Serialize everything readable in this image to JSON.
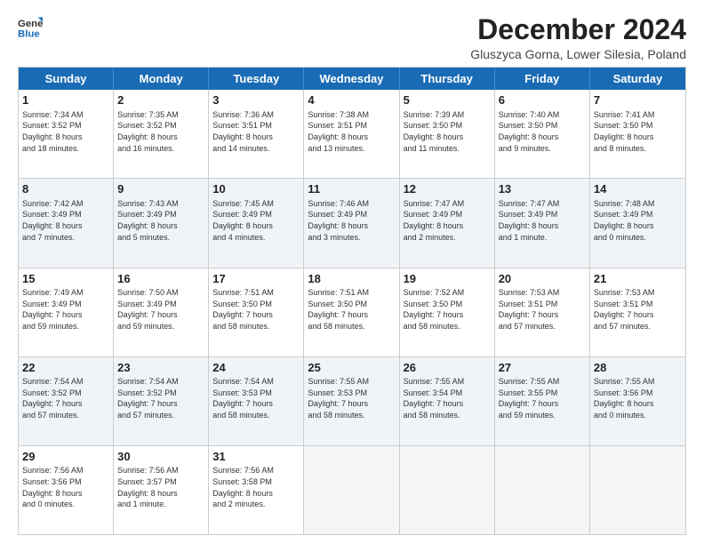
{
  "header": {
    "logo_line1": "General",
    "logo_line2": "Blue",
    "month_title": "December 2024",
    "location": "Gluszyca Gorna, Lower Silesia, Poland"
  },
  "weekdays": [
    "Sunday",
    "Monday",
    "Tuesday",
    "Wednesday",
    "Thursday",
    "Friday",
    "Saturday"
  ],
  "rows": [
    [
      {
        "day": "1",
        "lines": [
          "Sunrise: 7:34 AM",
          "Sunset: 3:52 PM",
          "Daylight: 8 hours",
          "and 18 minutes."
        ]
      },
      {
        "day": "2",
        "lines": [
          "Sunrise: 7:35 AM",
          "Sunset: 3:52 PM",
          "Daylight: 8 hours",
          "and 16 minutes."
        ]
      },
      {
        "day": "3",
        "lines": [
          "Sunrise: 7:36 AM",
          "Sunset: 3:51 PM",
          "Daylight: 8 hours",
          "and 14 minutes."
        ]
      },
      {
        "day": "4",
        "lines": [
          "Sunrise: 7:38 AM",
          "Sunset: 3:51 PM",
          "Daylight: 8 hours",
          "and 13 minutes."
        ]
      },
      {
        "day": "5",
        "lines": [
          "Sunrise: 7:39 AM",
          "Sunset: 3:50 PM",
          "Daylight: 8 hours",
          "and 11 minutes."
        ]
      },
      {
        "day": "6",
        "lines": [
          "Sunrise: 7:40 AM",
          "Sunset: 3:50 PM",
          "Daylight: 8 hours",
          "and 9 minutes."
        ]
      },
      {
        "day": "7",
        "lines": [
          "Sunrise: 7:41 AM",
          "Sunset: 3:50 PM",
          "Daylight: 8 hours",
          "and 8 minutes."
        ]
      }
    ],
    [
      {
        "day": "8",
        "lines": [
          "Sunrise: 7:42 AM",
          "Sunset: 3:49 PM",
          "Daylight: 8 hours",
          "and 7 minutes."
        ]
      },
      {
        "day": "9",
        "lines": [
          "Sunrise: 7:43 AM",
          "Sunset: 3:49 PM",
          "Daylight: 8 hours",
          "and 5 minutes."
        ]
      },
      {
        "day": "10",
        "lines": [
          "Sunrise: 7:45 AM",
          "Sunset: 3:49 PM",
          "Daylight: 8 hours",
          "and 4 minutes."
        ]
      },
      {
        "day": "11",
        "lines": [
          "Sunrise: 7:46 AM",
          "Sunset: 3:49 PM",
          "Daylight: 8 hours",
          "and 3 minutes."
        ]
      },
      {
        "day": "12",
        "lines": [
          "Sunrise: 7:47 AM",
          "Sunset: 3:49 PM",
          "Daylight: 8 hours",
          "and 2 minutes."
        ]
      },
      {
        "day": "13",
        "lines": [
          "Sunrise: 7:47 AM",
          "Sunset: 3:49 PM",
          "Daylight: 8 hours",
          "and 1 minute."
        ]
      },
      {
        "day": "14",
        "lines": [
          "Sunrise: 7:48 AM",
          "Sunset: 3:49 PM",
          "Daylight: 8 hours",
          "and 0 minutes."
        ]
      }
    ],
    [
      {
        "day": "15",
        "lines": [
          "Sunrise: 7:49 AM",
          "Sunset: 3:49 PM",
          "Daylight: 7 hours",
          "and 59 minutes."
        ]
      },
      {
        "day": "16",
        "lines": [
          "Sunrise: 7:50 AM",
          "Sunset: 3:49 PM",
          "Daylight: 7 hours",
          "and 59 minutes."
        ]
      },
      {
        "day": "17",
        "lines": [
          "Sunrise: 7:51 AM",
          "Sunset: 3:50 PM",
          "Daylight: 7 hours",
          "and 58 minutes."
        ]
      },
      {
        "day": "18",
        "lines": [
          "Sunrise: 7:51 AM",
          "Sunset: 3:50 PM",
          "Daylight: 7 hours",
          "and 58 minutes."
        ]
      },
      {
        "day": "19",
        "lines": [
          "Sunrise: 7:52 AM",
          "Sunset: 3:50 PM",
          "Daylight: 7 hours",
          "and 58 minutes."
        ]
      },
      {
        "day": "20",
        "lines": [
          "Sunrise: 7:53 AM",
          "Sunset: 3:51 PM",
          "Daylight: 7 hours",
          "and 57 minutes."
        ]
      },
      {
        "day": "21",
        "lines": [
          "Sunrise: 7:53 AM",
          "Sunset: 3:51 PM",
          "Daylight: 7 hours",
          "and 57 minutes."
        ]
      }
    ],
    [
      {
        "day": "22",
        "lines": [
          "Sunrise: 7:54 AM",
          "Sunset: 3:52 PM",
          "Daylight: 7 hours",
          "and 57 minutes."
        ]
      },
      {
        "day": "23",
        "lines": [
          "Sunrise: 7:54 AM",
          "Sunset: 3:52 PM",
          "Daylight: 7 hours",
          "and 57 minutes."
        ]
      },
      {
        "day": "24",
        "lines": [
          "Sunrise: 7:54 AM",
          "Sunset: 3:53 PM",
          "Daylight: 7 hours",
          "and 58 minutes."
        ]
      },
      {
        "day": "25",
        "lines": [
          "Sunrise: 7:55 AM",
          "Sunset: 3:53 PM",
          "Daylight: 7 hours",
          "and 58 minutes."
        ]
      },
      {
        "day": "26",
        "lines": [
          "Sunrise: 7:55 AM",
          "Sunset: 3:54 PM",
          "Daylight: 7 hours",
          "and 58 minutes."
        ]
      },
      {
        "day": "27",
        "lines": [
          "Sunrise: 7:55 AM",
          "Sunset: 3:55 PM",
          "Daylight: 7 hours",
          "and 59 minutes."
        ]
      },
      {
        "day": "28",
        "lines": [
          "Sunrise: 7:55 AM",
          "Sunset: 3:56 PM",
          "Daylight: 8 hours",
          "and 0 minutes."
        ]
      }
    ],
    [
      {
        "day": "29",
        "lines": [
          "Sunrise: 7:56 AM",
          "Sunset: 3:56 PM",
          "Daylight: 8 hours",
          "and 0 minutes."
        ]
      },
      {
        "day": "30",
        "lines": [
          "Sunrise: 7:56 AM",
          "Sunset: 3:57 PM",
          "Daylight: 8 hours",
          "and 1 minute."
        ]
      },
      {
        "day": "31",
        "lines": [
          "Sunrise: 7:56 AM",
          "Sunset: 3:58 PM",
          "Daylight: 8 hours",
          "and 2 minutes."
        ]
      },
      {
        "day": "",
        "lines": []
      },
      {
        "day": "",
        "lines": []
      },
      {
        "day": "",
        "lines": []
      },
      {
        "day": "",
        "lines": []
      }
    ]
  ]
}
